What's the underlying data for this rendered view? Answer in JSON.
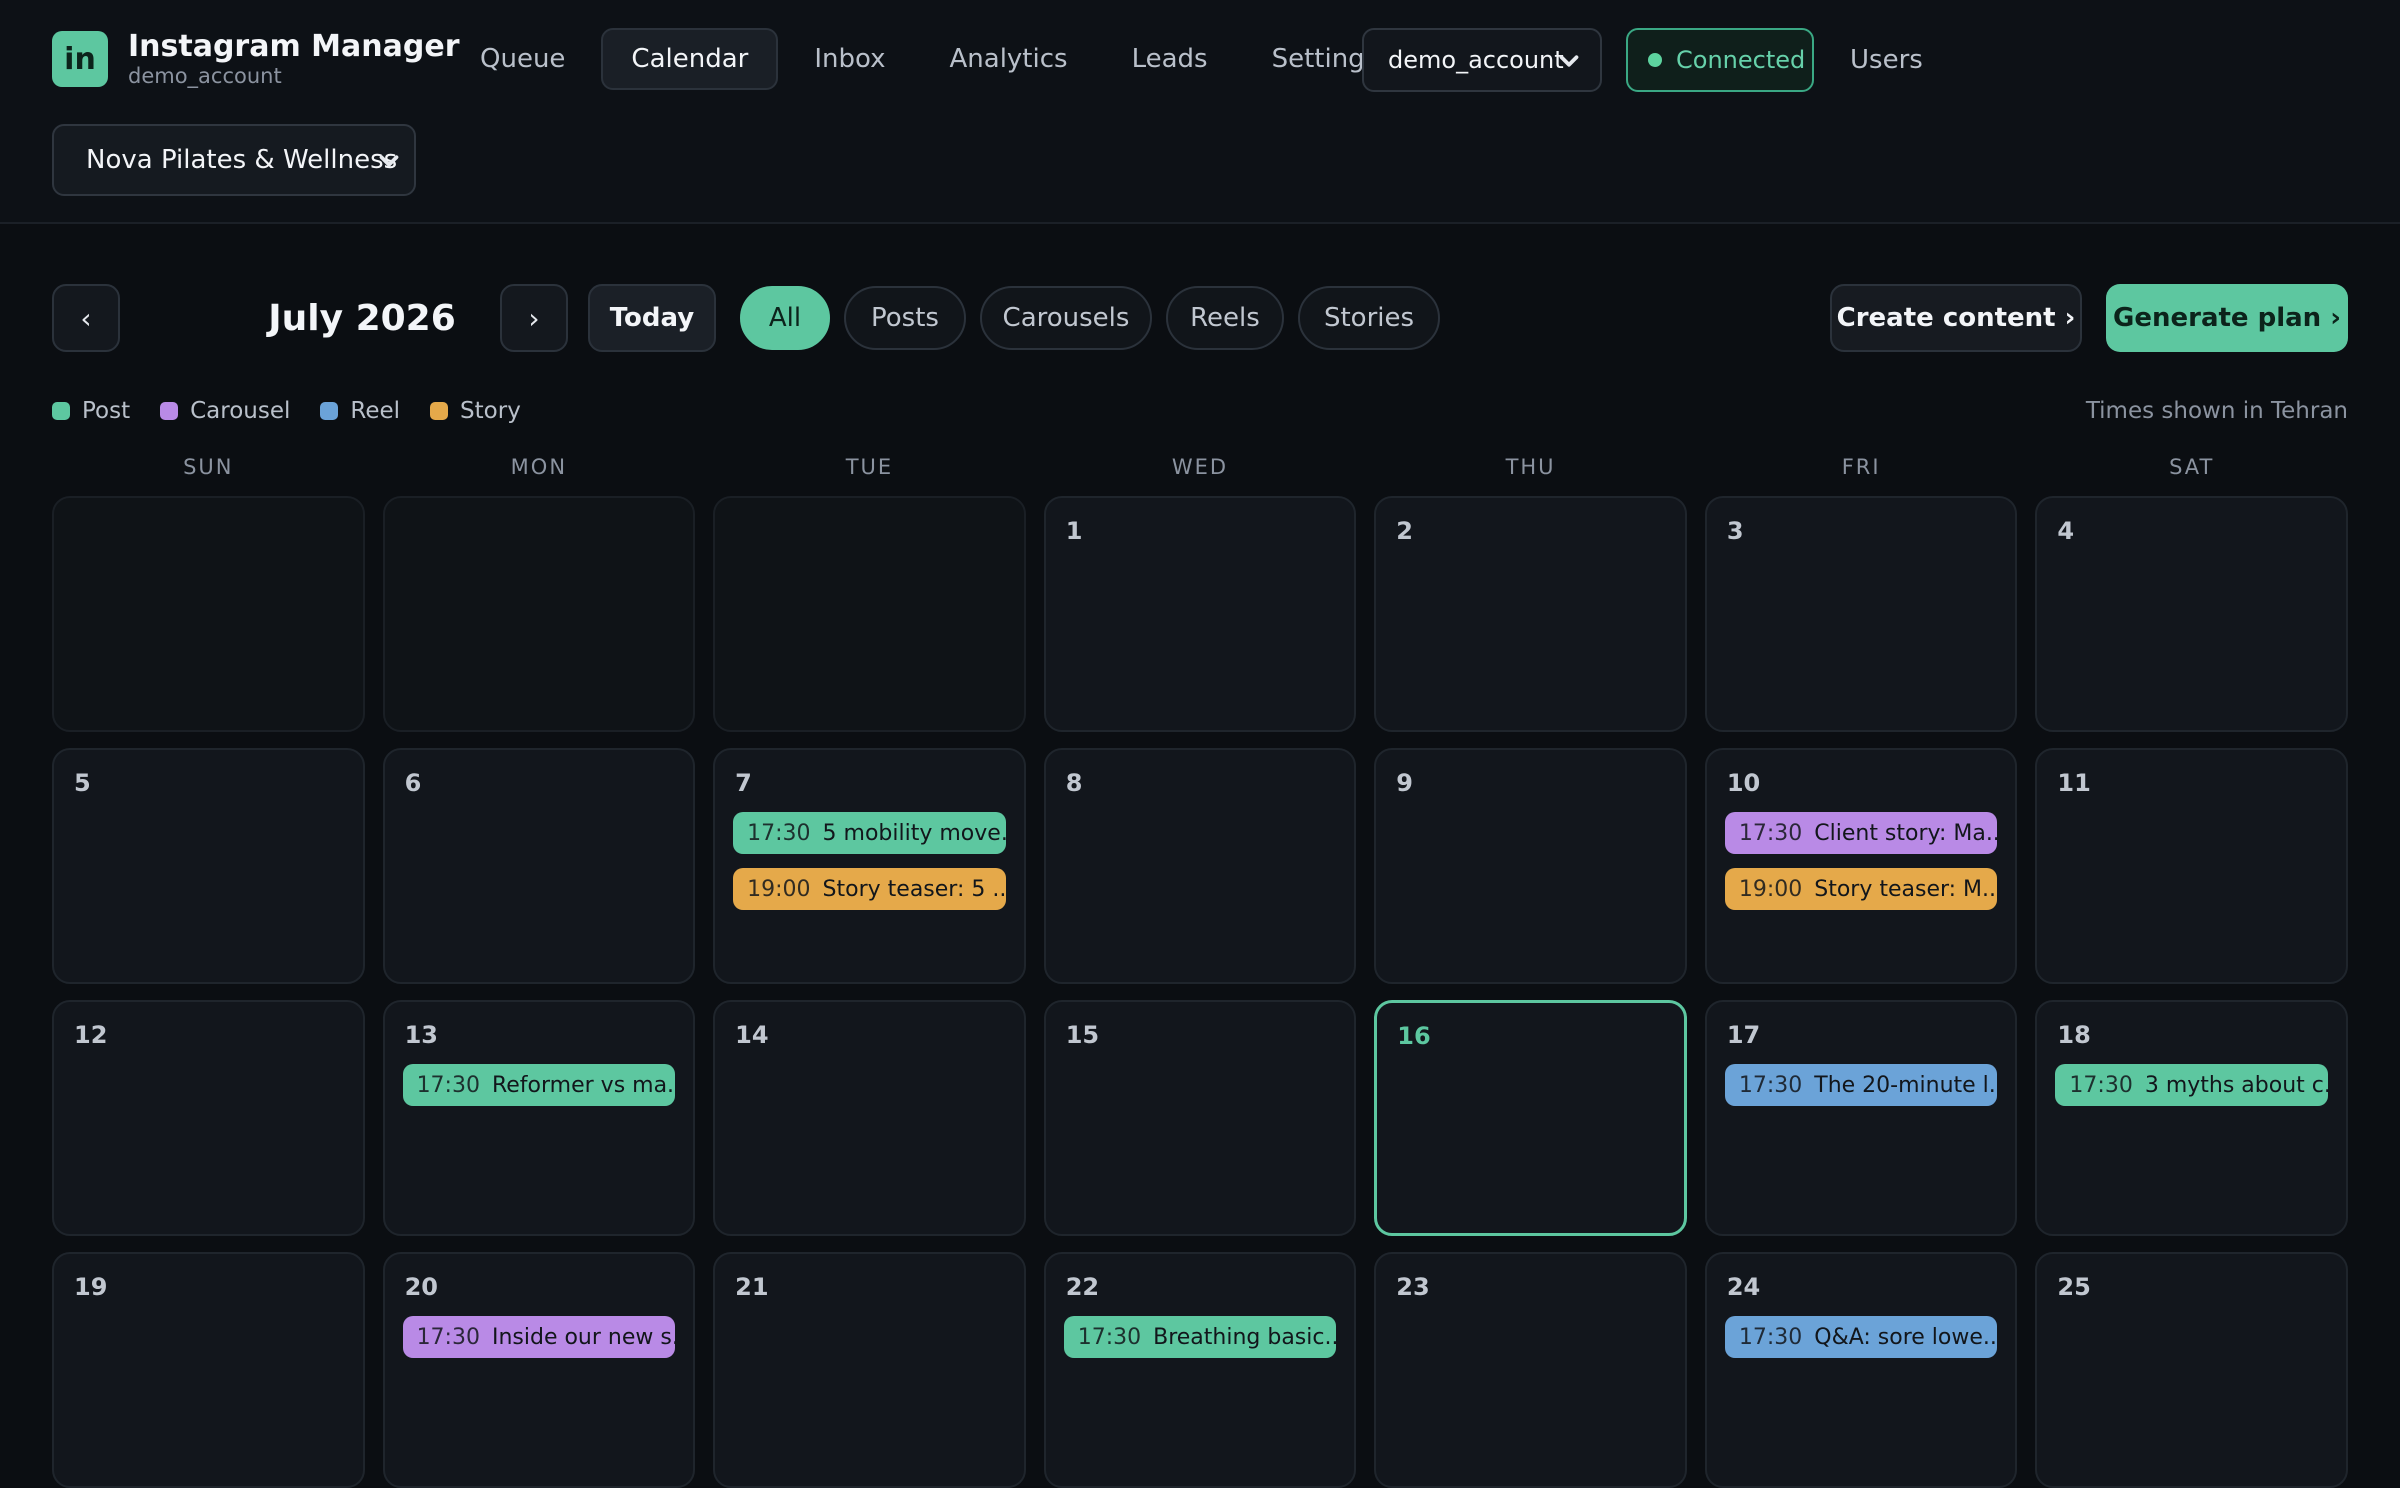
{
  "brand": {
    "logo": "in",
    "title": "Instagram Manager",
    "subtitle": "demo_account"
  },
  "nav": [
    {
      "label": "Queue",
      "active": false
    },
    {
      "label": "Calendar",
      "active": true
    },
    {
      "label": "Inbox",
      "active": false
    },
    {
      "label": "Analytics",
      "active": false
    },
    {
      "label": "Leads",
      "active": false
    },
    {
      "label": "Settings",
      "active": false
    }
  ],
  "account_select": {
    "value": "demo_account"
  },
  "status": {
    "label": "Connected",
    "color": "#5dd39f"
  },
  "users_link": "Users",
  "business_select": {
    "value": "Nova Pilates & Wellness"
  },
  "toolbar": {
    "prev_label": "‹",
    "month_label": "July 2026",
    "next_label": "›",
    "today_label": "Today",
    "filters": [
      {
        "label": "All",
        "active": true
      },
      {
        "label": "Posts",
        "active": false
      },
      {
        "label": "Carousels",
        "active": false
      },
      {
        "label": "Reels",
        "active": false
      },
      {
        "label": "Stories",
        "active": false
      }
    ],
    "create_label": "Create content ›",
    "generate_label": "Generate plan ›"
  },
  "legend": [
    {
      "label": "Post",
      "color": "#5dc7a0"
    },
    {
      "label": "Carousel",
      "color": "#b98ae6"
    },
    {
      "label": "Reel",
      "color": "#6ba3d8"
    },
    {
      "label": "Story",
      "color": "#e5a94a"
    }
  ],
  "timezone_note": "Times shown in Tehran",
  "weekdays": [
    "SUN",
    "MON",
    "TUE",
    "WED",
    "THU",
    "FRI",
    "SAT"
  ],
  "calendar": {
    "today": 16,
    "cells": [
      {
        "day": "",
        "events": []
      },
      {
        "day": "",
        "events": []
      },
      {
        "day": "",
        "events": []
      },
      {
        "day": "1",
        "events": []
      },
      {
        "day": "2",
        "events": []
      },
      {
        "day": "3",
        "events": []
      },
      {
        "day": "4",
        "events": []
      },
      {
        "day": "5",
        "events": []
      },
      {
        "day": "6",
        "events": []
      },
      {
        "day": "7",
        "events": [
          {
            "time": "17:30",
            "title": "5 mobility move...",
            "type": "post"
          },
          {
            "time": "19:00",
            "title": "Story teaser: 5 ...",
            "type": "story"
          }
        ]
      },
      {
        "day": "8",
        "events": []
      },
      {
        "day": "9",
        "events": []
      },
      {
        "day": "10",
        "events": [
          {
            "time": "17:30",
            "title": "Client story: Ma...",
            "type": "carousel"
          },
          {
            "time": "19:00",
            "title": "Story teaser: M...",
            "type": "story"
          }
        ]
      },
      {
        "day": "11",
        "events": []
      },
      {
        "day": "12",
        "events": []
      },
      {
        "day": "13",
        "events": [
          {
            "time": "17:30",
            "title": "Reformer vs ma...",
            "type": "post"
          }
        ]
      },
      {
        "day": "14",
        "events": []
      },
      {
        "day": "15",
        "events": []
      },
      {
        "day": "16",
        "events": []
      },
      {
        "day": "17",
        "events": [
          {
            "time": "17:30",
            "title": "The 20-minute l...",
            "type": "reel"
          }
        ]
      },
      {
        "day": "18",
        "events": [
          {
            "time": "17:30",
            "title": "3 myths about c...",
            "type": "post"
          }
        ]
      },
      {
        "day": "19",
        "events": []
      },
      {
        "day": "20",
        "events": [
          {
            "time": "17:30",
            "title": "Inside our new s...",
            "type": "carousel"
          }
        ]
      },
      {
        "day": "21",
        "events": []
      },
      {
        "day": "22",
        "events": [
          {
            "time": "17:30",
            "title": "Breathing basic...",
            "type": "post"
          }
        ]
      },
      {
        "day": "23",
        "events": []
      },
      {
        "day": "24",
        "events": [
          {
            "time": "17:30",
            "title": "Q&A: sore lowe...",
            "type": "reel"
          }
        ]
      },
      {
        "day": "25",
        "events": []
      }
    ]
  }
}
